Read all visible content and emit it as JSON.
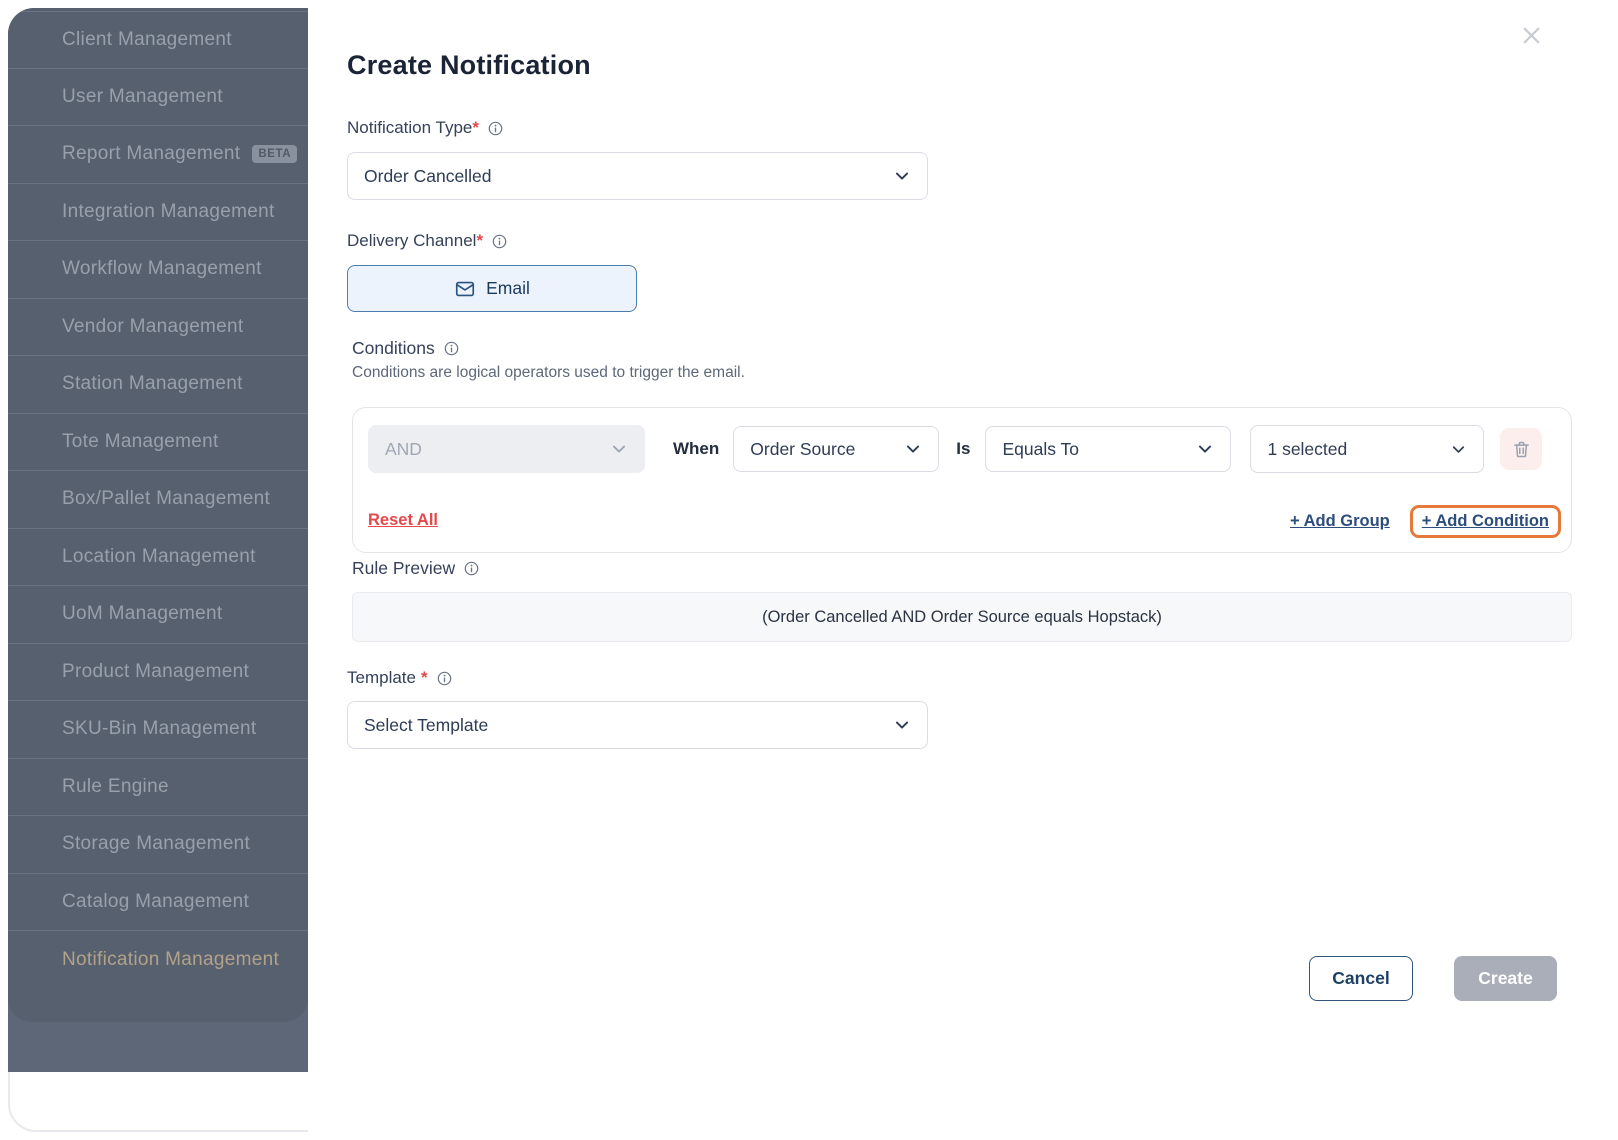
{
  "sidebar": {
    "items": [
      {
        "label": "Client Management"
      },
      {
        "label": "User Management"
      },
      {
        "label": "Report Management",
        "badge": "BETA"
      },
      {
        "label": "Integration Management"
      },
      {
        "label": "Workflow Management"
      },
      {
        "label": "Vendor Management"
      },
      {
        "label": "Station Management"
      },
      {
        "label": "Tote Management"
      },
      {
        "label": "Box/Pallet Management"
      },
      {
        "label": "Location Management"
      },
      {
        "label": "UoM Management"
      },
      {
        "label": "Product Management"
      },
      {
        "label": "SKU-Bin Management"
      },
      {
        "label": "Rule Engine"
      },
      {
        "label": "Storage Management"
      },
      {
        "label": "Catalog Management"
      },
      {
        "label": "Notification Management",
        "active": true
      }
    ]
  },
  "modal": {
    "title": "Create Notification",
    "notification_type": {
      "label": "Notification Type",
      "required_mark": "*",
      "value": "Order Cancelled"
    },
    "delivery_channel": {
      "label": "Delivery Channel",
      "required_mark": "*",
      "channel": "Email"
    },
    "conditions": {
      "label": "Conditions",
      "description": "Conditions are logical operators used to trigger the email.",
      "operator": "AND",
      "when_label": "When",
      "field": "Order Source",
      "is_label": "Is",
      "comparator": "Equals To",
      "value_summary": "1 selected",
      "reset_all": "Reset All",
      "add_group": "+ Add Group",
      "add_condition": "+ Add Condition"
    },
    "rule_preview": {
      "label": "Rule Preview",
      "value": "(Order Cancelled AND Order Source equals Hopstack)"
    },
    "template": {
      "label": "Template",
      "required_mark": "*",
      "value": "Select Template"
    },
    "footer": {
      "cancel": "Cancel",
      "create": "Create"
    }
  },
  "colors": {
    "highlight_orange": "#E5793A",
    "danger_red": "#E5484B",
    "link_navy": "#2D4D7C",
    "active_item_tan": "#B2A289",
    "sidebar_bg": "#57606F"
  }
}
